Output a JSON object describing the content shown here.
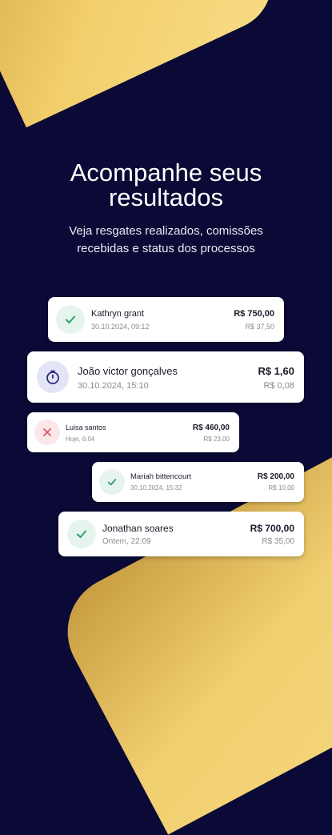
{
  "hero": {
    "title_line1": "Acompanhe seus",
    "title_line2": "resultados",
    "subtitle_line1": "Veja resgates realizados, comissões",
    "subtitle_line2": "recebidas e status dos processos"
  },
  "transactions": [
    {
      "name": "Kathryn grant",
      "date": "30.10.2024, 09:12",
      "amount": "R$ 750,00",
      "fee": "R$ 37,50",
      "status": "completed"
    },
    {
      "name": "João victor gonçalves",
      "date": "30.10.2024, 15:10",
      "amount": "R$ 1,60",
      "fee": "R$ 0,08",
      "status": "pending"
    },
    {
      "name": "Luisa santos",
      "date": "Hoje, 6:04",
      "amount": "R$ 460,00",
      "fee": "R$ 23,00",
      "status": "failed"
    },
    {
      "name": "Mariah bittencourt",
      "date": "30.10.2024, 15:32",
      "amount": "R$ 200,00",
      "fee": "R$ 10,00",
      "status": "completed"
    },
    {
      "name": "Jonathan soares",
      "date": "Ontem, 22:09",
      "amount": "R$ 700,00",
      "fee": "R$ 35,00",
      "status": "completed"
    }
  ],
  "colors": {
    "background": "#0b0a36",
    "gold": "#f2cf6c",
    "success": "#2f9e6a",
    "pending": "#2b2f7a",
    "error": "#e0526b"
  }
}
